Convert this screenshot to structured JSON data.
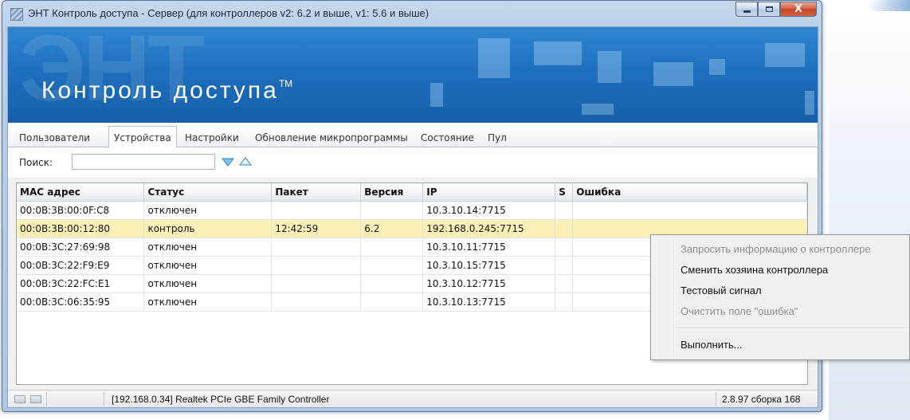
{
  "window": {
    "title": "ЭНТ Контроль доступа - Сервер (для контроллеров v2: 6.2  и выше, v1: 5.6 и выше)",
    "close_label": "X"
  },
  "banner": {
    "big_text": "ЭНТ",
    "product_name": "Контроль доступа",
    "trademark": "TM"
  },
  "tabs": [
    {
      "label": "Пользователи"
    },
    {
      "label": "Устройства",
      "active": true
    },
    {
      "label": "Настройки"
    },
    {
      "label": "Обновление микропрограммы"
    },
    {
      "label": "Состояние"
    },
    {
      "label": "Пул"
    }
  ],
  "search": {
    "label": "Поиск:",
    "value": "",
    "next_icon": "triangle-down-icon",
    "prev_icon": "triangle-up-icon"
  },
  "table": {
    "columns": [
      "MAC адрес",
      "Статус",
      "Пакет",
      "Версия",
      "IP",
      "S",
      "Ошибка"
    ],
    "rows": [
      {
        "mac": "00:0B:3B:00:0F:C8",
        "status": "отключен",
        "packet": "",
        "version": "",
        "ip": "10.3.10.14:7715",
        "s": "",
        "error": "",
        "selected": false
      },
      {
        "mac": "00:0B:3B:00:12:80",
        "status": "контроль",
        "packet": "12:42:59",
        "version": "6.2",
        "ip": "192.168.0.245:7715",
        "s": "",
        "error": "",
        "selected": true
      },
      {
        "mac": "00:0B:3C:27:69:98",
        "status": "отключен",
        "packet": "",
        "version": "",
        "ip": "10.3.10.11:7715",
        "s": "",
        "error": "",
        "selected": false
      },
      {
        "mac": "00:0B:3C:22:F9:E9",
        "status": "отключен",
        "packet": "",
        "version": "",
        "ip": "10.3.10.15:7715",
        "s": "",
        "error": "",
        "selected": false
      },
      {
        "mac": "00:0B:3C:22:FC:E1",
        "status": "отключен",
        "packet": "",
        "version": "",
        "ip": "10.3.10.12:7715",
        "s": "",
        "error": "",
        "selected": false
      },
      {
        "mac": "00:0B:3C:06:35:95",
        "status": "отключен",
        "packet": "",
        "version": "",
        "ip": "10.3.10.13:7715",
        "s": "",
        "error": "",
        "selected": false
      }
    ]
  },
  "statusbar": {
    "adapter": "[192.168.0.34] Realtek PCIe GBE Family Controller",
    "version": "2.8.97 сборка 168"
  },
  "context_menu": {
    "items": [
      {
        "label": "Запросить информацию о контроллере",
        "enabled": false
      },
      {
        "label": "Сменить хозяина контроллера",
        "enabled": true
      },
      {
        "label": "Тестовый сигнал",
        "enabled": true
      },
      {
        "label": "Очистить поле \"ошибка\"",
        "enabled": false
      },
      {
        "label": "Выполнить...",
        "enabled": true
      }
    ]
  },
  "colors": {
    "banner": "#1e6fbd",
    "selected_row": "#fbf1b7",
    "disabled_text": "#8d8d8d"
  }
}
